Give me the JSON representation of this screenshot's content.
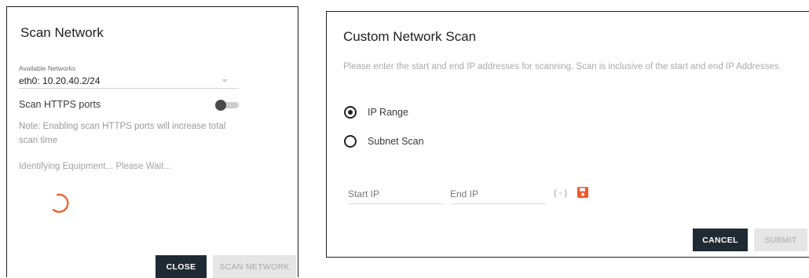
{
  "scan_dialog": {
    "title": "Scan Network",
    "networks_label": "Available Networks",
    "network_value": "eth0: 10.20.40.2/24",
    "https_toggle_label": "Scan HTTPS ports",
    "https_toggle_on": false,
    "note": "Note: Enabling scan HTTPS ports will increase total scan time",
    "status": "Identifying Equipment... Please Wait...",
    "close_label": "CLOSE",
    "scan_label": "SCAN NETWORK"
  },
  "custom_dialog": {
    "title": "Custom Network Scan",
    "description": "Please enter the start and end IP addresses for scanning. Scan is inclusive of the start and end IP Addresses.",
    "options": [
      {
        "label": "IP Range",
        "selected": true
      },
      {
        "label": "Subnet Scan",
        "selected": false
      }
    ],
    "start_ip_placeholder": "Start IP",
    "end_ip_placeholder": "End IP",
    "range_separator": "( - )",
    "cancel_label": "CANCEL",
    "submit_label": "SUBMIT"
  },
  "colors": {
    "accent": "#f05a28",
    "dark_button": "#1f2a33",
    "disabled_button": "#e6e6e6"
  },
  "icons": {
    "spinner": "loading-spinner-icon",
    "save": "save-icon"
  }
}
